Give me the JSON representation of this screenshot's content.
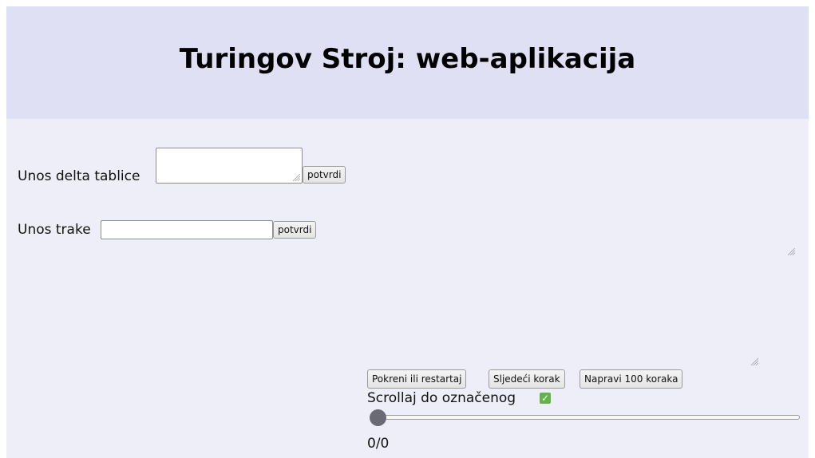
{
  "header": {
    "title": "Turingov Stroj: web-aplikacija"
  },
  "delta_table": {
    "label": "Unos delta tablice",
    "value": "",
    "confirm_label": "potvrdi"
  },
  "tape": {
    "label": "Unos trake",
    "value": "",
    "confirm_label": "potvrdi"
  },
  "controls": {
    "start_label": "Pokreni ili restartaj",
    "next_label": "Sljedeći korak",
    "hundred_label": "Napravi 100 koraka",
    "scroll_label": "Scrollaj do označenog",
    "scroll_checked": true
  },
  "slider": {
    "value": 0,
    "max": 0
  },
  "step_counter": "0/0",
  "icons": {
    "checkbox": "checkmark-icon",
    "resize": "resize-grip-icon"
  },
  "colors": {
    "header_bg": "#e0e0f4",
    "page_bg": "#eeeef9",
    "checkbox": "#63b34a"
  }
}
